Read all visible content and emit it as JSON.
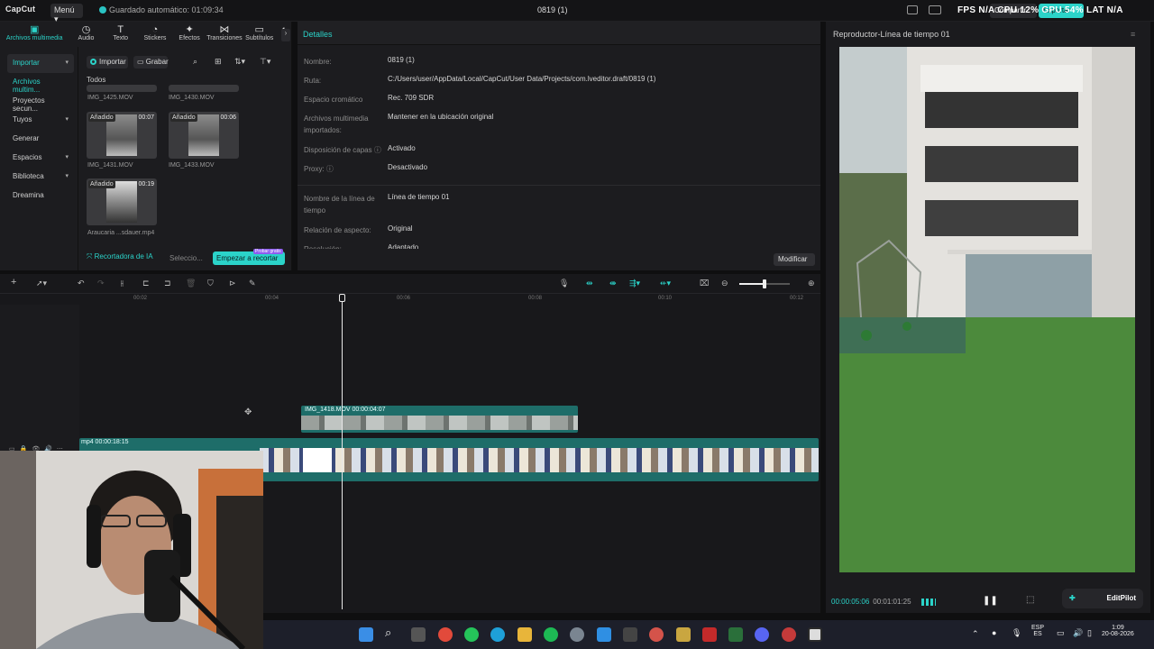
{
  "app": {
    "logo": "CapCut",
    "menu_label": "Menú",
    "autosave": "Guardado automático: 01:09:34",
    "project_title": "0819 (1)",
    "share_label": "Compartir",
    "export_label": "Exportar",
    "stats": "FPS N/A   CPU 12%   GPU 54%   LAT N/A"
  },
  "toolbar_tabs": [
    {
      "icon": "media-icon",
      "glyph": "▣",
      "label": "Archivos multimedia"
    },
    {
      "icon": "audio-icon",
      "glyph": "◷",
      "label": "Audio"
    },
    {
      "icon": "text-icon",
      "glyph": "T",
      "label": "Texto"
    },
    {
      "icon": "sticker-icon",
      "glyph": "◔",
      "label": "Stickers"
    },
    {
      "icon": "effects-icon",
      "glyph": "✦",
      "label": "Efectos"
    },
    {
      "icon": "transitions-icon",
      "glyph": "⋈",
      "label": "Transiciones"
    },
    {
      "icon": "subtitles-icon",
      "glyph": "▭",
      "label": "Subtítulos"
    },
    {
      "icon": "filters-icon",
      "glyph": "◐",
      "label": "Fi"
    }
  ],
  "sidebar": [
    {
      "label": "Importar",
      "state": "active"
    },
    {
      "label": "Archivos multim...",
      "state": "sel"
    },
    {
      "label": "Proyectos secun...",
      "state": ""
    },
    {
      "label": "Tuyos",
      "state": ""
    },
    {
      "label": "Generar",
      "state": ""
    },
    {
      "label": "Espacios",
      "state": ""
    },
    {
      "label": "Biblioteca",
      "state": ""
    },
    {
      "label": "Dreamina",
      "state": ""
    }
  ],
  "media_actions": {
    "import": "Importar",
    "record": "Grabar"
  },
  "media_filter": "Todos",
  "media_items": [
    {
      "name": "IMG_1425.MOV",
      "badge": "",
      "duration": ""
    },
    {
      "name": "IMG_1430.MOV",
      "badge": "",
      "duration": ""
    },
    {
      "name": "IMG_1431.MOV",
      "badge": "Añadido",
      "duration": "00:07"
    },
    {
      "name": "IMG_1433.MOV",
      "badge": "Añadido",
      "duration": "00:06"
    },
    {
      "name": "Araucaria ...sdauer.mp4",
      "badge": "Añadido",
      "duration": "00:19"
    }
  ],
  "ai_cut": {
    "label": "Recortadora de IA",
    "select": "Seleccio...",
    "button": "Empezar a recortar",
    "badge": "Probar gratis"
  },
  "details": {
    "header": "Detalles",
    "rows": [
      {
        "label": "Nombre:",
        "value": "0819 (1)"
      },
      {
        "label": "Ruta:",
        "value": "C:/Users/user/AppData/Local/CapCut/User Data/Projects/com.lveditor.draft/0819 (1)"
      },
      {
        "label": "Espacio cromático",
        "value": "Rec. 709 SDR"
      },
      {
        "label": "Archivos multimedia importados:",
        "value": "Mantener en la ubicación original"
      },
      {
        "label": "Disposición de capas ⓘ",
        "value": "Activado"
      },
      {
        "label": "Proxy: ⓘ",
        "value": "Desactivado"
      },
      {
        "label": "Nombre de la línea de tiempo",
        "value": "Línea de tiempo 01"
      },
      {
        "label": "Relación de aspecto:",
        "value": "Original"
      },
      {
        "label": "Resolución:",
        "value": "Adaptado"
      }
    ],
    "modify_button": "Modificar"
  },
  "player": {
    "title": "Reproductor-Línea de tiempo 01",
    "current_time": "00:00:05:06",
    "total_time": "00:01:01:25",
    "editpilot": "EditPilot"
  },
  "timeline": {
    "ruler": [
      "00:02",
      "00:04",
      "00:06",
      "00:08",
      "00:10",
      "00:12"
    ],
    "top_clip": "IMG_1418.MOV   00:00:04:07",
    "main_clip": "mp4   00:00:18:15"
  },
  "taskbar": {
    "lang_top": "ESP",
    "lang_bottom": "ES",
    "time": "1:09",
    "date": "20-08-2026"
  }
}
